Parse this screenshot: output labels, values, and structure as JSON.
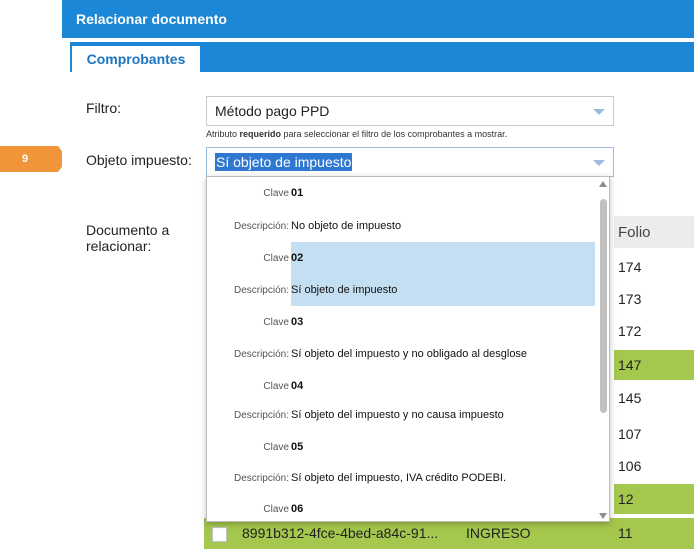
{
  "step_marker": "9",
  "dialog": {
    "title": "Relacionar documento",
    "tab": "Comprobantes"
  },
  "filtro": {
    "label": "Filtro:",
    "value": "Método pago PPD",
    "hint_prefix": "Atributo ",
    "hint_bold": "requerido",
    "hint_suffix": " para seleccionar el filtro de los comprobantes a mostrar."
  },
  "objeto": {
    "label": "Objeto impuesto:",
    "value": "Sí objeto de impuesto"
  },
  "documento": {
    "label_line1": "Documento a",
    "label_line2": "relacionar:"
  },
  "dropdown": {
    "clave_label": "Clave",
    "desc_label": "Descripción:",
    "options": [
      {
        "clave": "01",
        "descripcion": "No objeto de impuesto",
        "selected": false
      },
      {
        "clave": "02",
        "descripcion": "Sí objeto de impuesto",
        "selected": true
      },
      {
        "clave": "03",
        "descripcion": "Sí objeto del impuesto y no obligado al desglose",
        "selected": false
      },
      {
        "clave": "04",
        "descripcion": "Sí objeto del impuesto y no causa impuesto",
        "selected": false
      },
      {
        "clave": "05",
        "descripcion": "Sí objeto del impuesto, IVA crédito PODEBI.",
        "selected": false
      },
      {
        "clave": "06",
        "descripcion": "",
        "selected": false
      }
    ]
  },
  "table": {
    "folio_header": "Folio",
    "folios": [
      "174",
      "173",
      "172",
      "147",
      "145",
      "107",
      "106",
      "12"
    ],
    "bottom_row": {
      "uuid": "8991b312-4fce-4bed-a84c-91...",
      "tipo": "INGRESO",
      "folio": "11"
    }
  },
  "colors": {
    "accent": "#1b87d6",
    "green_row": "#a4c74d",
    "marker": "#f0953a",
    "highlight": "#c5dff2"
  }
}
